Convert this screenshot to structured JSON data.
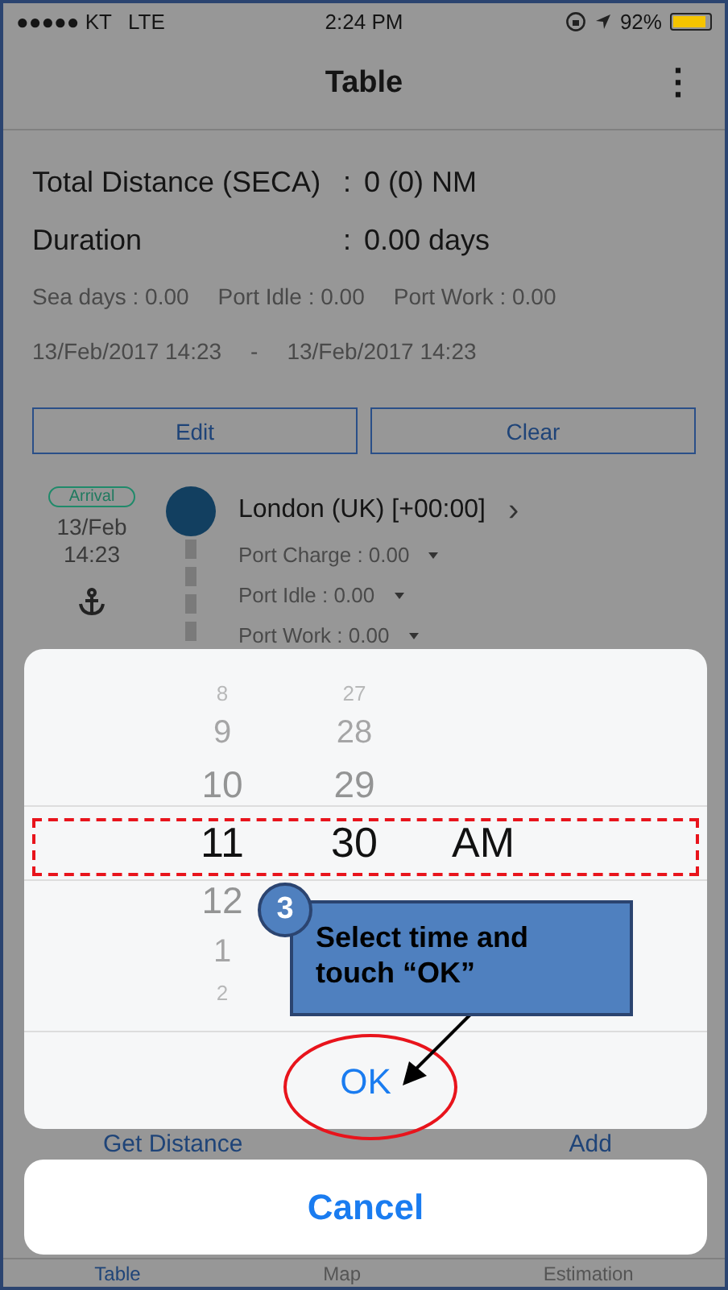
{
  "status_bar": {
    "carrier": "●●●●● KT",
    "network": "LTE",
    "time": "2:24 PM",
    "battery": "92%"
  },
  "nav": {
    "title": "Table",
    "menu": "⋮"
  },
  "summary": {
    "distance_label": "Total Distance (SECA)",
    "distance_sep": ":",
    "distance_value": "0 (0) NM",
    "duration_label": "Duration",
    "duration_sep": ":",
    "duration_value": "0.00 days",
    "breakdown": [
      "Sea days : 0.00",
      "Port Idle : 0.00",
      "Port Work : 0.00"
    ],
    "start": "13/Feb/2017 14:23",
    "dash": "-",
    "end": "13/Feb/2017 14:23"
  },
  "buttons": [
    "Edit",
    "Clear"
  ],
  "port": {
    "badge": "Arrival",
    "date": "13/Feb",
    "time": "14:23",
    "name": "London (UK) [+00:00]",
    "chevron": "›",
    "rows": [
      "Port Charge : 0.00",
      "Port Idle : 0.00",
      "Port Work : 0.00"
    ]
  },
  "actions": [
    "Get Distance",
    "Add"
  ],
  "tabs": [
    {
      "label": "Table",
      "selected": true
    },
    {
      "label": "Map",
      "selected": false
    },
    {
      "label": "Estimation",
      "selected": false
    }
  ],
  "picker": {
    "columns": [
      {
        "items": [
          {
            "text": "8",
            "selected": false
          },
          {
            "text": "9",
            "selected": false
          },
          {
            "text": "10",
            "selected": false
          },
          {
            "text": "11",
            "selected": true
          },
          {
            "text": "12",
            "selected": false
          },
          {
            "text": "1",
            "selected": false
          },
          {
            "text": "2",
            "selected": false
          }
        ]
      },
      {
        "items": [
          {
            "text": "27",
            "selected": false
          },
          {
            "text": "28",
            "selected": false
          },
          {
            "text": "29",
            "selected": false
          },
          {
            "text": "30",
            "selected": true
          }
        ]
      },
      {
        "items": [
          {
            "text": "AM",
            "selected": true
          }
        ]
      }
    ]
  },
  "ok": "OK",
  "cancel": "Cancel",
  "callout": {
    "step": "3",
    "text": "Select time and touch “OK”"
  }
}
